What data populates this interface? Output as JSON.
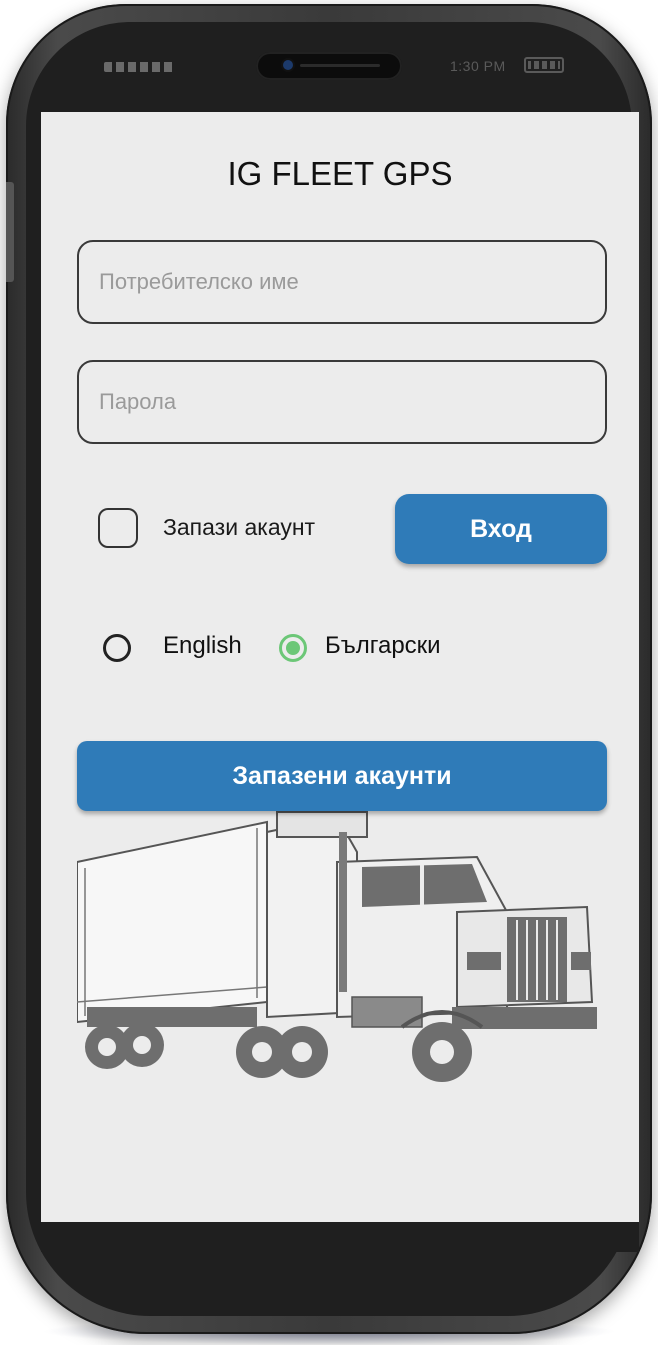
{
  "status_bar": {
    "time": "1:30 PM"
  },
  "app": {
    "title": "IG FLEET GPS"
  },
  "login_form": {
    "username_placeholder": "Потребителско име",
    "password_placeholder": "Парола",
    "remember_label": "Запази акаунт",
    "remember_checked": false,
    "login_button_label": "Вход"
  },
  "language": {
    "options": [
      {
        "label": "English",
        "selected": false
      },
      {
        "label": "Български",
        "selected": true
      }
    ],
    "selected_color": "#6cc777"
  },
  "saved_accounts": {
    "button_label": "Запазени акаунти"
  },
  "theme": {
    "accent": "#2f7bb8",
    "screen_bg": "#ececec",
    "truck_icon": "truck-illustration"
  }
}
